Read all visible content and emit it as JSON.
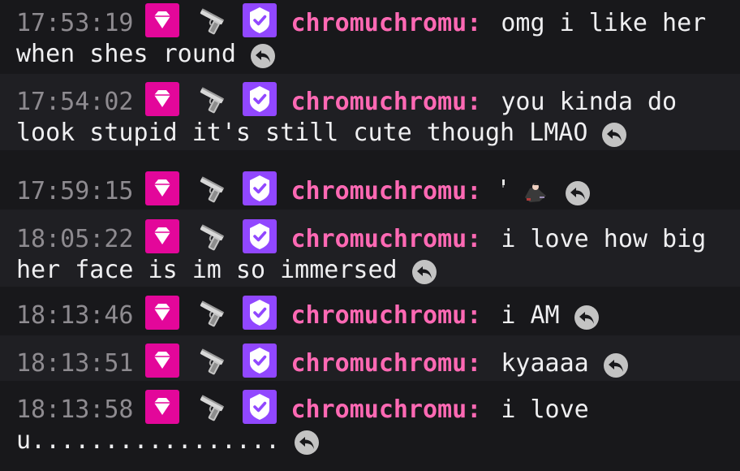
{
  "chat": {
    "username": "chromuchromu",
    "colon": ":",
    "user_color": "#ff69b4",
    "badges": [
      "diamond-sub-badge",
      "pistol-badge",
      "verified-badge"
    ],
    "messages": [
      {
        "time": "17:53:19",
        "text": "omg i like her when shes round"
      },
      {
        "time": "17:54:02",
        "text": "you kinda do look stupid it's still cute though LMAO"
      },
      {
        "time": "17:59:15",
        "text": "",
        "emote": "tiny-character-emote"
      },
      {
        "time": "18:05:22",
        "text": "i love how big her face is im so immersed"
      },
      {
        "time": "18:13:46",
        "text": "i AM"
      },
      {
        "time": "18:13:51",
        "text": "kyaaaa"
      },
      {
        "time": "18:13:58",
        "text": "i love u................."
      }
    ]
  }
}
